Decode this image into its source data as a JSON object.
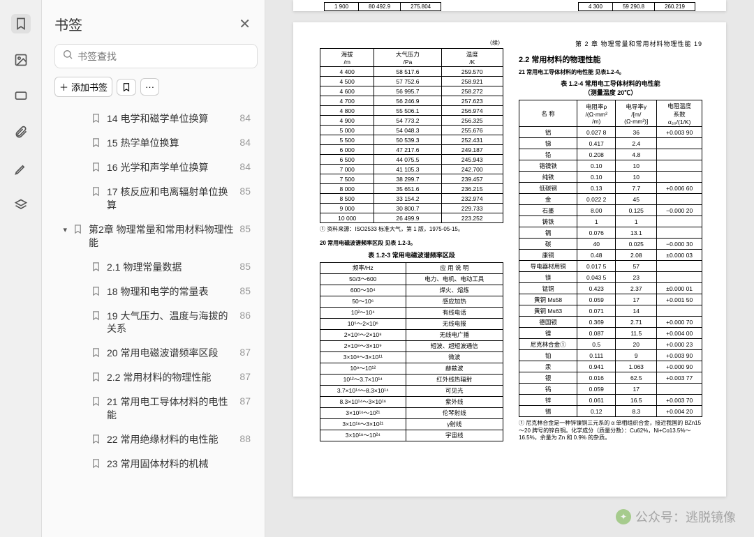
{
  "sidebar": {
    "title": "书签",
    "search_placeholder": "书签查找",
    "add_label": "添加书签",
    "items": [
      {
        "indent": 1,
        "caret": "",
        "label": "14 电学和磁学单位换算",
        "page": "84"
      },
      {
        "indent": 1,
        "caret": "",
        "label": "15 热学单位换算",
        "page": "84"
      },
      {
        "indent": 1,
        "caret": "",
        "label": "16 光学和声学单位换算",
        "page": "84"
      },
      {
        "indent": 1,
        "caret": "",
        "label": "17 核反应和电离辐射单位换算",
        "page": "85"
      },
      {
        "indent": 0,
        "caret": "▾",
        "label": "第2章 物理常量和常用材料物理性能",
        "page": "85"
      },
      {
        "indent": 1,
        "caret": "",
        "label": "2.1 物理常量数据",
        "page": "85"
      },
      {
        "indent": 1,
        "caret": "",
        "label": "18 物理和电学的常量表",
        "page": "85"
      },
      {
        "indent": 1,
        "caret": "",
        "label": "19 大气压力、温度与海拔的关系",
        "page": "86"
      },
      {
        "indent": 1,
        "caret": "",
        "label": "20 常用电磁波谱频率区段",
        "page": "87"
      },
      {
        "indent": 1,
        "caret": "",
        "label": "2.2 常用材料的物理性能",
        "page": "87"
      },
      {
        "indent": 1,
        "caret": "",
        "label": "21 常用电工导体材料的电性能",
        "page": "87"
      },
      {
        "indent": 1,
        "caret": "",
        "label": "22 常用绝缘材料的电性能",
        "page": "88"
      },
      {
        "indent": 1,
        "caret": "",
        "label": "23 常用固体材料的机械",
        "page": ""
      }
    ]
  },
  "top_strip": {
    "r1": [
      "1 900",
      "80 492.9",
      "275.804"
    ],
    "r2": [
      "4 300",
      "59 290.8",
      "260.219"
    ]
  },
  "page": {
    "header": "第 2 章  物理常量和常用材料物理性能   19",
    "left": {
      "cont": "（续）",
      "t1_head": [
        "海拔\n/m",
        "大气压力\n/Pa",
        "温度\n/K"
      ],
      "t1_rows": [
        [
          "4 400",
          "58 517.6",
          "259.570"
        ],
        [
          "4 500",
          "57 752.6",
          "258.921"
        ],
        [
          "4 600",
          "56 995.7",
          "258.272"
        ],
        [
          "4 700",
          "56 246.9",
          "257.623"
        ],
        [
          "4 800",
          "55 506.1",
          "256.974"
        ],
        [
          "4 900",
          "54 773.2",
          "256.325"
        ],
        [
          "5 000",
          "54 048.3",
          "255.676"
        ],
        [
          "5 500",
          "50 539.3",
          "252.431"
        ],
        [
          "6 000",
          "47 217.6",
          "249.187"
        ],
        [
          "6 500",
          "44 075.5",
          "245.943"
        ],
        [
          "7 000",
          "41 105.3",
          "242.700"
        ],
        [
          "7 500",
          "38 299.7",
          "239.457"
        ],
        [
          "8 000",
          "35 651.6",
          "236.215"
        ],
        [
          "8 500",
          "33 154.2",
          "232.974"
        ],
        [
          "9 000",
          "30 800.7",
          "229.733"
        ],
        [
          "10 000",
          "26 499.9",
          "223.252"
        ]
      ],
      "note1": "① 资料来源：ISO2533 标准大气，第 1 版，1975-05-15。",
      "sub20": "20  常用电磁波谱频率区段    见表 1.2-3。",
      "t2_title": "表 1.2-3  常用电磁波谱频率区段",
      "t2_head": [
        "频率/Hz",
        "应 用 说 明"
      ],
      "t2_rows": [
        [
          "50/3～600",
          "电力、电机、电动工具"
        ],
        [
          "600～10⁴",
          "焊火、熔炼"
        ],
        [
          "50～10⁶",
          "感应加热"
        ],
        [
          "10²～10⁴",
          "有线电话"
        ],
        [
          "10⁵～2×10⁶",
          "无线电报"
        ],
        [
          "2×10⁶～2×10⁸",
          "无线电广播"
        ],
        [
          "2×10⁸～3×10⁹",
          "短波、超短波通信"
        ],
        [
          "3×10⁸～3×10¹¹",
          "微波"
        ],
        [
          "10⁹～10¹²",
          "赫兹波"
        ],
        [
          "10¹²～3.7×10¹⁴",
          "红外线热辐射"
        ],
        [
          "3.7×10¹⁴～8.3×10¹⁴",
          "可见光"
        ],
        [
          "8.3×10¹⁴～3×10¹⁶",
          "紫外线"
        ],
        [
          "3×10¹⁶～10²¹",
          "伦琴射线"
        ],
        [
          "3×10¹⁸～3×10²¹",
          "γ射线"
        ],
        [
          "3×10¹⁸～10²⁴",
          "宇宙线"
        ]
      ]
    },
    "right": {
      "sec": "2.2  常用材料的物理性能",
      "sub21": "21  常用电工导体材料的电性能    见表1.2-4。",
      "t3_title": "表 1.2-4  常用电工导体材料的电性能\n（测量温度 20℃）",
      "t3_head": [
        "名  称",
        "电阻率ρ\n/(Ω·mm²\n/m)",
        "电导率γ\n/[m/\n(Ω·mm²)]",
        "电阻温度\n系数\nα₂₀/(1/K)"
      ],
      "t3_rows": [
        [
          "铝",
          "0.027 8",
          "36",
          "+0.003 90"
        ],
        [
          "锑",
          "0.417",
          "2.4",
          ""
        ],
        [
          "铅",
          "0.208",
          "4.8",
          ""
        ],
        [
          "铬镍铁",
          "0.10",
          "10",
          ""
        ],
        [
          "纯铁",
          "0.10",
          "10",
          ""
        ],
        [
          "低碳钢",
          "0.13",
          "7.7",
          "+0.006 60"
        ],
        [
          "金",
          "0.022 2",
          "45",
          ""
        ],
        [
          "石墨",
          "8.00",
          "0.125",
          "−0.000 20"
        ],
        [
          "铸铁",
          "1",
          "1",
          ""
        ],
        [
          "镉",
          "0.076",
          "13.1",
          ""
        ],
        [
          "碳",
          "40",
          "0.025",
          "−0.000 30"
        ],
        [
          "康铜",
          "0.48",
          "2.08",
          "±0.000 03"
        ],
        [
          "导电器材用铜",
          "0.017 5",
          "57",
          ""
        ],
        [
          "镁",
          "0.043 5",
          "23",
          ""
        ],
        [
          "锰铜",
          "0.423",
          "2.37",
          "±0.000 01"
        ],
        [
          "黄铜 Ms58",
          "0.059",
          "17",
          "+0.001 50"
        ],
        [
          "黄铜 Ms63",
          "0.071",
          "14",
          ""
        ],
        [
          "德国银",
          "0.369",
          "2.71",
          "+0.000 70"
        ],
        [
          "镍",
          "0.087",
          "11.5",
          "+0.004 00"
        ],
        [
          "尼克林合金①",
          "0.5",
          "20",
          "+0.000 23"
        ],
        [
          "铂",
          "0.111",
          "9",
          "+0.003 90"
        ],
        [
          "汞",
          "0.941",
          "1.063",
          "+0.000 90"
        ],
        [
          "银",
          "0.016",
          "62.5",
          "+0.003 77"
        ],
        [
          "钨",
          "0.059",
          "17",
          ""
        ],
        [
          "锌",
          "0.061",
          "16.5",
          "+0.003 70"
        ],
        [
          "锡",
          "0.12",
          "8.3",
          "+0.004 20"
        ]
      ],
      "note2": "① 尼克林合金是一种锌镍铜三元系的 α 单相组织合金，接近我国的 BZn15～20 牌号的锌白铜。化学成分（质量分数）：Cu62%，Ni+Co13.5%～16.5%，余量为 Zn 和 0.9% 的杂质。"
    }
  },
  "watermark": "公众号：逃脱镜像"
}
